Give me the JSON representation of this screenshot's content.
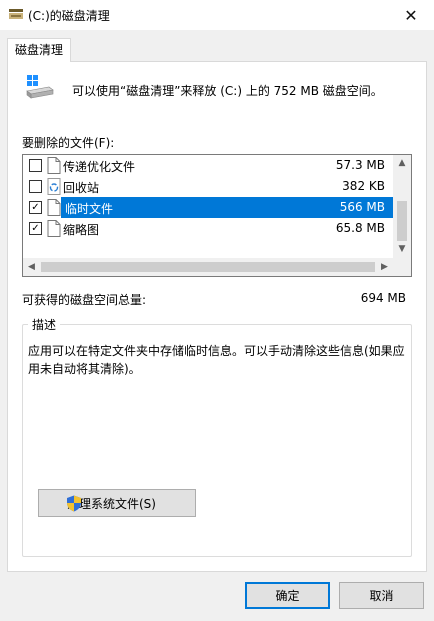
{
  "window": {
    "title": "(C:)的磁盘清理",
    "close_glyph": "✕"
  },
  "tab": {
    "label": "磁盘清理"
  },
  "summary": {
    "text": "可以使用“磁盘清理”来释放  (C:) 上的 752 MB 磁盘空间。"
  },
  "file_list": {
    "label": "要删除的文件(F):",
    "items": [
      {
        "name": "传递优化文件",
        "size": "57.3 MB",
        "checked": false,
        "selected": false,
        "icon": "file-icon"
      },
      {
        "name": "回收站",
        "size": "382 KB",
        "checked": false,
        "selected": false,
        "icon": "recycle-bin-icon"
      },
      {
        "name": "临时文件",
        "size": "566 MB",
        "checked": true,
        "selected": true,
        "icon": "file-icon"
      },
      {
        "name": "缩略图",
        "size": "65.8 MB",
        "checked": true,
        "selected": false,
        "icon": "file-icon"
      }
    ]
  },
  "total": {
    "label": "可获得的磁盘空间总量:",
    "value": "694 MB"
  },
  "description": {
    "title": "描述",
    "text": "应用可以在特定文件夹中存储临时信息。可以手动清除这些信息(如果应用未自动将其清除)。"
  },
  "buttons": {
    "clean_system": "清理系统文件(S)",
    "ok": "确定",
    "cancel": "取消"
  },
  "colors": {
    "accent": "#0078d7",
    "window_bg": "#f0f0f0",
    "panel_bg": "#ffffff"
  }
}
